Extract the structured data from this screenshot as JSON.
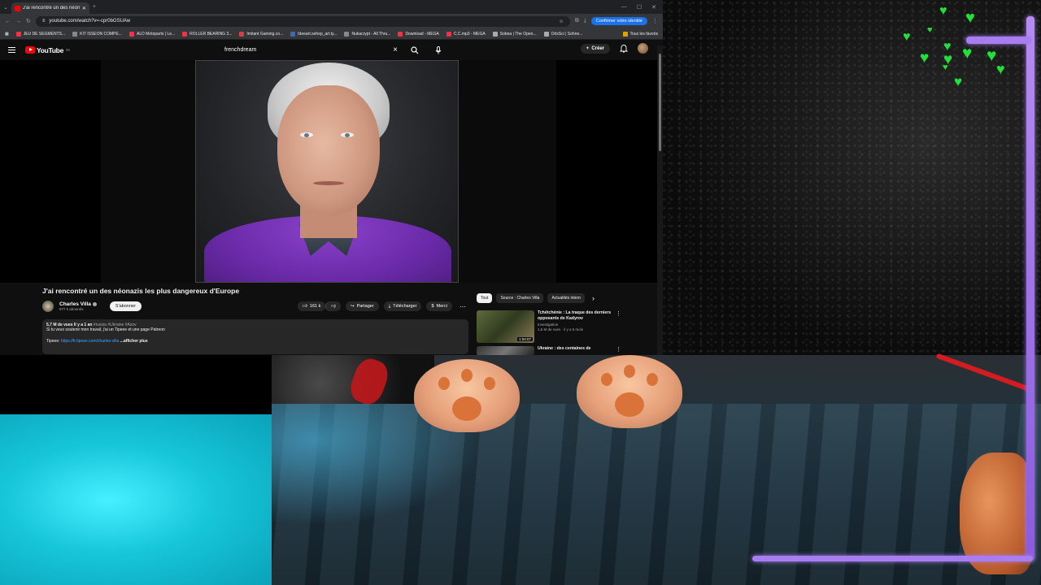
{
  "browser": {
    "tab_title": "J'ai rencontré un des néona...",
    "url": "youtube.com/watch?v=-cpr0bGSUAw",
    "verify_label": "Confirmer votre identité",
    "bookmarks": [
      "JEU DE SEGMENTS...",
      "KIT ISSEON COMPE...",
      "ALD Motoparts | Le...",
      "ROLLER BEARING 3...",
      "Imitant Gaming.co...",
      "Ideeart.sehep_art.ty...",
      "Nukacrypt - All Thru...",
      "Download - MEGA",
      "C.C.mp3 - MEGA",
      "Sobea | The Open...",
      "OrlsSci | Sohne..."
    ],
    "bookmarks_all": "Tous les favoris"
  },
  "youtube": {
    "logo": "YouTube",
    "logo_region": "FR",
    "search_value": "frenchdream",
    "create_label": "Créer",
    "video_title": "J'ai rencontré un des néonazis les plus dangereux d'Europe",
    "channel_name": "Charles Villa",
    "channel_subs": "977 k abonnés",
    "subscribe_label": "S'abonner",
    "likes": "161 k",
    "share_label": "Partager",
    "download_label": "Télécharger",
    "thanks_label": "Merci",
    "desc_meta": "5,7 M de vues  Il y a 1 an",
    "desc_tags": "#russia #Ukraine #Azov",
    "desc_line1": "Si tu veux soutenir mon travail, j'ai un Tipeee et une page Patreon",
    "desc_tipeee_label": "Tipeee:",
    "desc_tipeee_link": "https://fr.tipeee.com/charles-villa",
    "desc_more": "...afficher plus",
    "chips": [
      "Tout",
      "Source : Charles Villa",
      "Actualités intern"
    ],
    "recommendations": [
      {
        "title": "Tchétchénie : La traque des derniers opposants de Kadyrov",
        "channel": "Investigation",
        "meta": "1,6 M de vues · il y a 5 mois",
        "duration": "1:04:07"
      },
      {
        "title": "Ukraine : des centaines de",
        "channel": "",
        "meta": "",
        "duration": ""
      }
    ]
  },
  "colors": {
    "yt_red": "#ff0000",
    "heart_green": "#22e03a",
    "frame_purple": "#a77df0",
    "cyan_panel": "#17c6da"
  }
}
